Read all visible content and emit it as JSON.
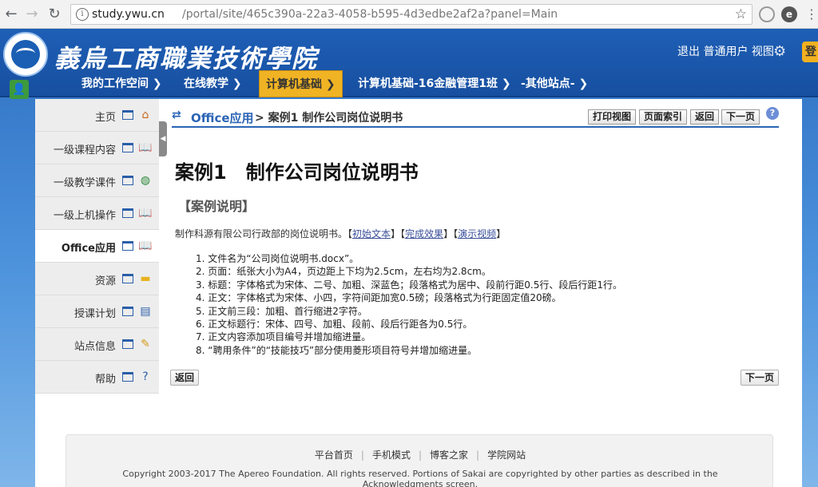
{
  "browser": {
    "url_host": "study.ywu.cn",
    "url_path": "/portal/site/465c390a-22a3-4058-b595-4d3edbe2af2a?panel=Main"
  },
  "header": {
    "brand": "義烏工商職業技術學院",
    "user_area": "退出 普通用户 视图",
    "nav": [
      {
        "label": "我的工作空间 ❯"
      },
      {
        "label": "在线教学 ❯"
      },
      {
        "label": "计算机基础 ❯"
      },
      {
        "label": "计算机基础-16金融管理1班 ❯"
      },
      {
        "label": "-其他站点- ❯"
      }
    ]
  },
  "sidebar": {
    "items": [
      {
        "label": "主页",
        "icon": "home-icon"
      },
      {
        "label": "一级课程内容",
        "icon": "book-icon"
      },
      {
        "label": "一级教学课件",
        "icon": "globe-icon"
      },
      {
        "label": "一级上机操作",
        "icon": "book-icon"
      },
      {
        "label": "Office应用",
        "icon": "book-icon"
      },
      {
        "label": "资源",
        "icon": "folder-icon"
      },
      {
        "label": "授课计划",
        "icon": "document-icon"
      },
      {
        "label": "站点信息",
        "icon": "edit-icon"
      },
      {
        "label": "帮助",
        "icon": "help-icon"
      }
    ]
  },
  "content": {
    "breadcrumb_link": "Office应用",
    "breadcrumb_current": "> 案例1 制作公司岗位说明书",
    "buttons": {
      "print": "打印视图",
      "index": "页面索引",
      "back": "返回",
      "next": "下一页"
    },
    "title": "案例1　制作公司岗位说明书",
    "section_heading": "【案例说明】",
    "intro_text": "制作科源有限公司行政部的岗位说明书。【",
    "link_initial": "初始文本",
    "link_result": "完成效果",
    "link_video": "演示视频",
    "steps": [
      "1. 文件名为“公司岗位说明书.docx”。",
      "2. 页面：纸张大小为A4，页边距上下均为2.5cm，左右均为2.8cm。",
      "3. 标题：字体格式为宋体、二号、加粗、深蓝色；段落格式为居中、段前行距0.5行、段后行距1行。",
      "4. 正文：字体格式为宋体、小四，字符间距加宽0.5磅；段落格式为行距固定值20磅。",
      "5. 正文前三段：加粗、首行缩进2字符。",
      "6. 正文标题行：宋体、四号、加粗、段前、段后行距各为0.5行。",
      "7. 正文内容添加项目编号并增加缩进量。",
      "8. “聘用条件”的“技能技巧”部分使用菱形项目符号并增加缩进量。"
    ],
    "bottom_back": "返回",
    "bottom_next": "下一页"
  },
  "footer": {
    "links": [
      "平台首页",
      "手机模式",
      "博客之家",
      "学院网站"
    ],
    "copyright": "Copyright 2003-2017 The Apereo Foundation. All rights reserved. Portions of Sakai are copyrighted by other parties as described in the Acknowledgments screen."
  }
}
